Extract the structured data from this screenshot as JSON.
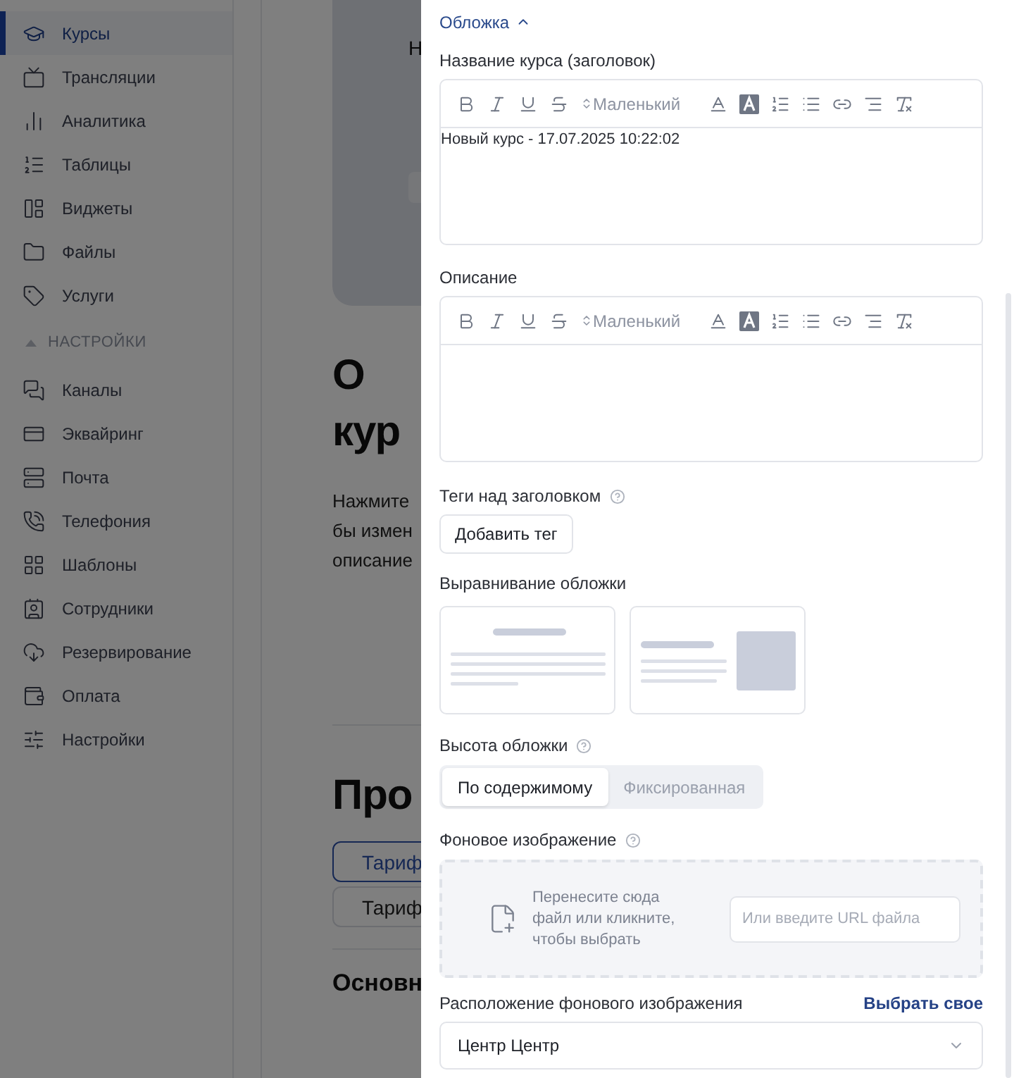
{
  "sidebar": {
    "items": [
      {
        "label": "Курсы",
        "selected": true
      },
      {
        "label": "Трансляции",
        "selected": false
      },
      {
        "label": "Аналитика",
        "selected": false
      },
      {
        "label": "Таблицы",
        "selected": false
      },
      {
        "label": "Виджеты",
        "selected": false
      },
      {
        "label": "Файлы",
        "selected": false
      },
      {
        "label": "Услуги",
        "selected": false
      }
    ],
    "section": {
      "label": "НАСТРОЙКИ",
      "expanded": true
    },
    "section_items": [
      {
        "label": "Каналы",
        "selected": false
      },
      {
        "label": "Эквайринг",
        "selected": false
      },
      {
        "label": "Почта",
        "selected": false
      },
      {
        "label": "Телефония",
        "selected": false
      },
      {
        "label": "Шаблоны",
        "selected": false
      },
      {
        "label": "Сотрудники",
        "selected": false
      },
      {
        "label": "Резервирование",
        "selected": false
      },
      {
        "label": "Оплата",
        "selected": false
      },
      {
        "label": "Настройки",
        "selected": false
      }
    ]
  },
  "page": {
    "cover_letter": "Н",
    "about_title": [
      "О",
      "кур"
    ],
    "about_text": [
      "Нажмите",
      "бы измен",
      "описание"
    ],
    "products_title": "Про",
    "tariffs": [
      {
        "label": "Тариф",
        "selected": true
      },
      {
        "label": "Тариф",
        "selected": false
      }
    ],
    "basics_title": "Основн"
  },
  "drawer": {
    "section_toggle": {
      "label": "Обложка",
      "expanded": true
    },
    "title_field": {
      "label": "Название курса (заголовок)",
      "size": "Маленький",
      "value": "Новый курс - 17.07.2025 10:22:02"
    },
    "description_field": {
      "label": "Описание",
      "size": "Маленький"
    },
    "tags": {
      "label": "Теги над заголовком",
      "button": "Добавить тег"
    },
    "alignment": {
      "label": "Выравнивание обложки",
      "options": [
        {
          "kind": "centered",
          "selected": false
        },
        {
          "kind": "side-image",
          "selected": false
        }
      ]
    },
    "height": {
      "label": "Высота обложки",
      "options": [
        {
          "label": "По содержимому",
          "selected": true
        },
        {
          "label": "Фиксированная",
          "selected": false
        }
      ]
    },
    "background": {
      "label": "Фоновое изображение",
      "drop_text": "Перенесите сюда файл или кликните, чтобы выбрать",
      "url_placeholder": "Или введите URL файла"
    },
    "position": {
      "label": "Расположение фонового изображения",
      "link": "Выбрать свое",
      "value": "Центр Центр"
    }
  }
}
